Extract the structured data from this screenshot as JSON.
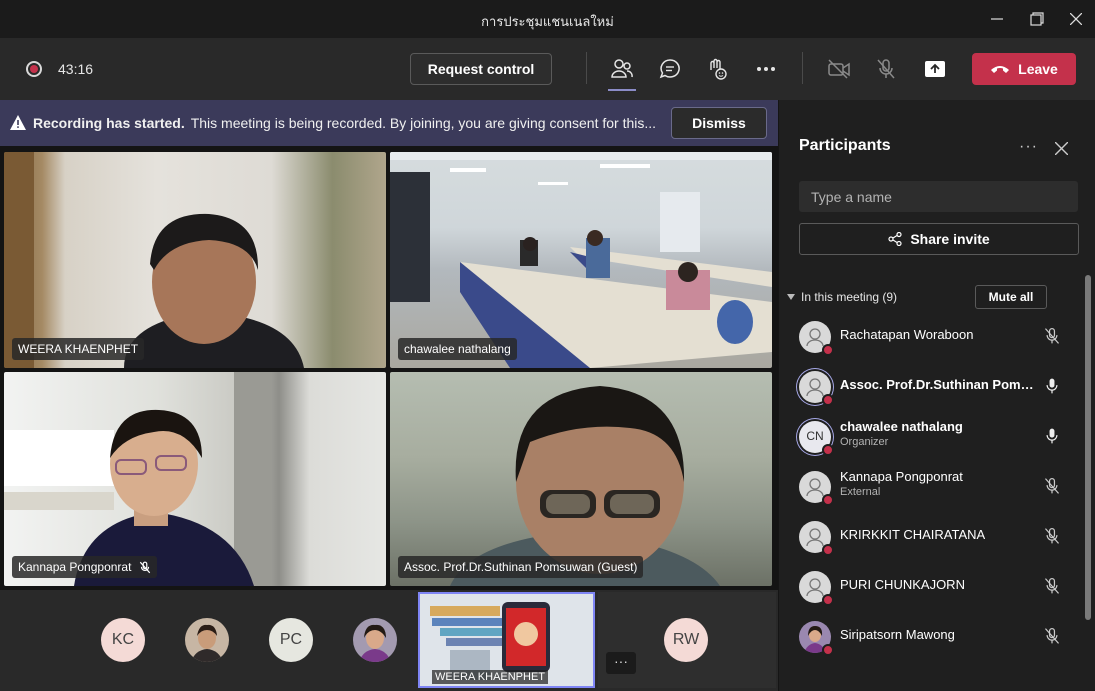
{
  "window": {
    "title": "การประชุมแชนเนลใหม่"
  },
  "toolbar": {
    "timer": "43:16",
    "request_control_label": "Request control",
    "leave_label": "Leave",
    "accent_color": "#c4314b"
  },
  "banner": {
    "bold": "Recording has started.",
    "message": "This meeting is being recorded. By joining, you are giving consent for this...",
    "dismiss_label": "Dismiss"
  },
  "videos": [
    {
      "name": "WEERA KHAENPHET"
    },
    {
      "name": "chawalee nathalang"
    },
    {
      "name": "Kannapa Pongponrat"
    },
    {
      "name": "Assoc. Prof.Dr.Suthinan Pomsuwan (Guest)"
    }
  ],
  "gallery": {
    "avatars": [
      "KC",
      "PC",
      "RW"
    ],
    "screen_share_label": "WEERA KHAENPHET",
    "more_label": "···"
  },
  "panel": {
    "title": "Participants",
    "search_placeholder": "Type a name",
    "share_invite_label": "Share invite",
    "section_label": "In this meeting (9)",
    "mute_all_label": "Mute all",
    "participants": [
      {
        "name": "Rachatapan Woraboon",
        "role": "",
        "mic": "muted"
      },
      {
        "name": "Assoc. Prof.Dr.Suthinan Poms...",
        "role": "",
        "mic": "on"
      },
      {
        "name": "chawalee nathalang",
        "role": "Organizer",
        "mic": "on",
        "initials": "CN"
      },
      {
        "name": "Kannapa Pongponrat",
        "role": "External",
        "mic": "muted"
      },
      {
        "name": "KRIRKKIT CHAIRATANA",
        "role": "",
        "mic": "muted"
      },
      {
        "name": "PURI CHUNKAJORN",
        "role": "",
        "mic": "muted"
      },
      {
        "name": "Siripatsorn Mawong",
        "role": "",
        "mic": "muted"
      }
    ]
  }
}
